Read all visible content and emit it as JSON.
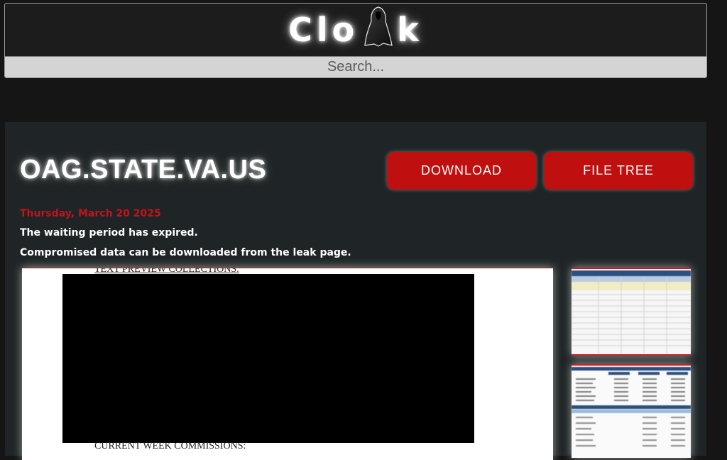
{
  "site": {
    "logo_text_left": "Clo",
    "logo_text_right": "k",
    "search_placeholder": "Search..."
  },
  "post": {
    "title": "OAG.STATE.VA.US",
    "date": "Thursday, March 20 2025",
    "line1": "The waiting period has expired.",
    "line2": "Compromised data can be downloaded from the leak page."
  },
  "buttons": {
    "download": "DOWNLOAD",
    "file_tree": "FILE TREE"
  },
  "preview": {
    "top_text": "TEXT PREVIEW COLLECTIONS:",
    "bottom_text": "CURRENT WEEK COMMISSIONS:"
  },
  "colors": {
    "accent_red": "#bf0f0f",
    "date_red": "#c4121b",
    "panel_bg": "#1f2526",
    "page_bg": "#151515"
  },
  "icons": {
    "logo_figure": "hooded-cloak-figure-icon"
  }
}
